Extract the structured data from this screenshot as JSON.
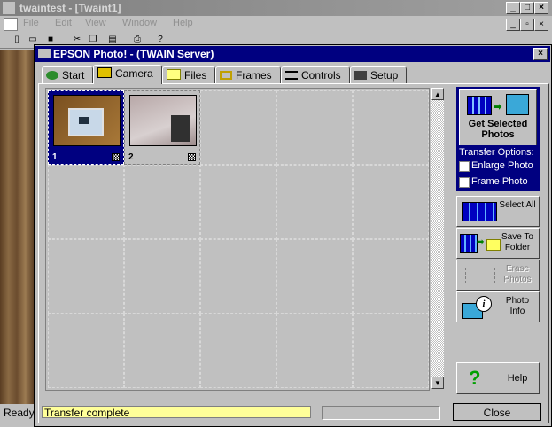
{
  "app": {
    "title": "twaintest - [Twaint1]",
    "menu": [
      "File",
      "Edit",
      "View",
      "Window",
      "Help"
    ],
    "status": "Ready"
  },
  "dialog": {
    "title": "EPSON Photo! - (TWAIN Server)",
    "tabs": [
      {
        "label": "Start",
        "icon": "start-icon"
      },
      {
        "label": "Camera",
        "icon": "camera-icon",
        "active": true
      },
      {
        "label": "Files",
        "icon": "folder-icon"
      },
      {
        "label": "Frames",
        "icon": "frame-icon"
      },
      {
        "label": "Controls",
        "icon": "controls-icon"
      },
      {
        "label": "Setup",
        "icon": "setup-icon"
      }
    ],
    "photos": [
      {
        "number": "1",
        "selected": true
      },
      {
        "number": "2",
        "selected": false
      }
    ],
    "get_selected": "Get Selected Photos",
    "transfer": {
      "heading": "Transfer Options:",
      "enlarge": "Enlarge Photo",
      "frame": "Frame Photo"
    },
    "buttons": {
      "select_all": "Select All",
      "save_to_folder": "Save To Folder",
      "erase_photos": "Erase Photos",
      "photo_info": "Photo Info",
      "help": "Help",
      "close": "Close"
    },
    "status_message": "Transfer complete"
  }
}
